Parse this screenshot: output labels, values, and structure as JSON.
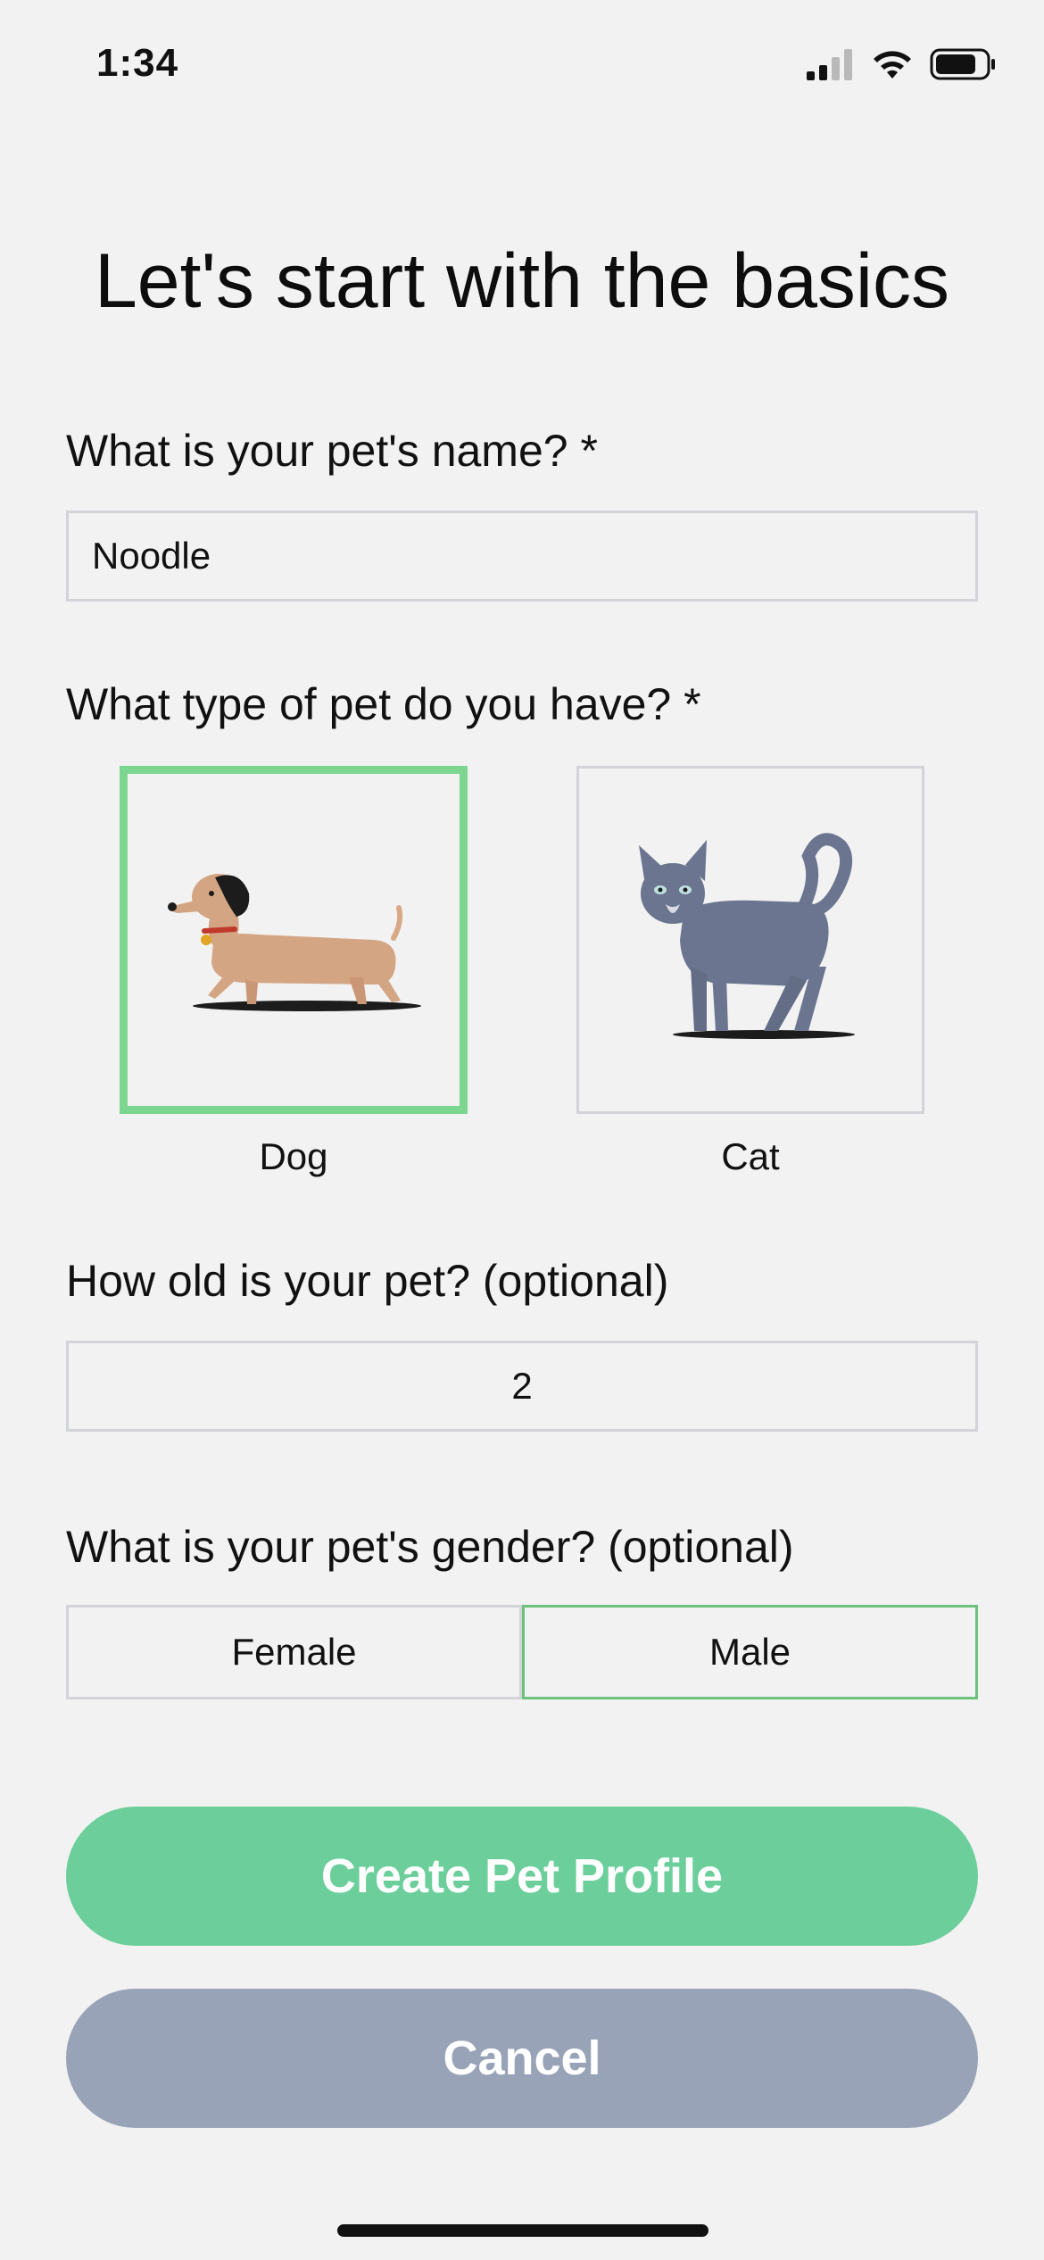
{
  "status_bar": {
    "time": "1:34",
    "icons": [
      "cellular-signal-icon",
      "wifi-icon",
      "battery-icon"
    ]
  },
  "title": "Let's start with the basics",
  "name_section": {
    "label": "What is your pet's name? *",
    "value": "Noodle"
  },
  "type_section": {
    "label": "What type of pet do you have? *",
    "options": [
      {
        "label": "Dog",
        "icon": "dog-illustration",
        "selected": true
      },
      {
        "label": "Cat",
        "icon": "cat-illustration",
        "selected": false
      }
    ]
  },
  "age_section": {
    "label": "How old is your pet? (optional)",
    "value": "2"
  },
  "gender_section": {
    "label": "What is your pet's gender? (optional)",
    "options": [
      {
        "label": "Female",
        "selected": false
      },
      {
        "label": "Male",
        "selected": true
      }
    ]
  },
  "buttons": {
    "create": "Create Pet Profile",
    "cancel": "Cancel"
  },
  "colors": {
    "background": "#f2f2f2",
    "selected_green": "#7dd68f",
    "primary_button": "#6ccf9b",
    "secondary_button": "#98a3b8",
    "field_border": "#d3d4d9"
  }
}
